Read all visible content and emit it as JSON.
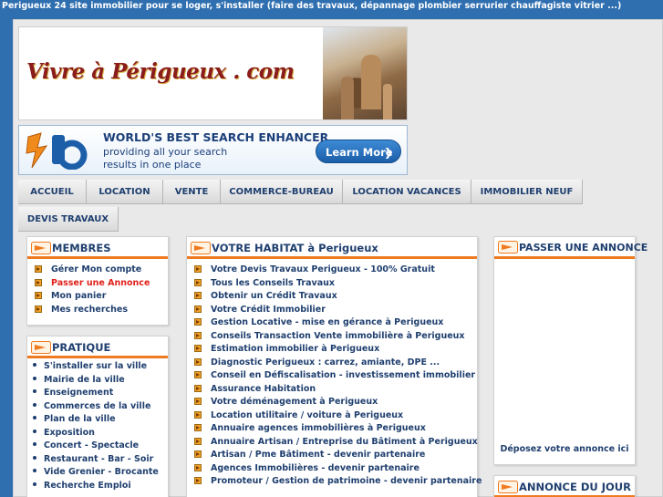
{
  "site_tagline": "Perigueux 24 site immobilier pour se loger, s'installer (faire des travaux, dépannage plombier serrurier chauffagiste vitrier ...)",
  "header": {
    "logo_text": "Vivre à Périgueux . com"
  },
  "banner": {
    "title": "WORLD'S BEST SEARCH ENHANCER",
    "line1": "providing all your search",
    "line2": "results in one place",
    "button_label": "Learn More"
  },
  "nav": {
    "items": [
      {
        "label": "ACCUEIL"
      },
      {
        "label": "LOCATION"
      },
      {
        "label": "VENTE"
      },
      {
        "label": "COMMERCE-BUREAU"
      },
      {
        "label": "LOCATION VACANCES"
      },
      {
        "label": "IMMOBILIER NEUF"
      },
      {
        "label": "DEVIS TRAVAUX"
      }
    ]
  },
  "membres": {
    "title": "MEMBRES",
    "items": [
      {
        "label": "Gérer Mon compte"
      },
      {
        "label": "Passer une Annonce"
      },
      {
        "label": "Mon panier"
      },
      {
        "label": "Mes recherches"
      }
    ]
  },
  "pratique": {
    "title": "PRATIQUE",
    "items": [
      {
        "label": "S'installer sur la ville"
      },
      {
        "label": "Mairie de la ville"
      },
      {
        "label": "Enseignement"
      },
      {
        "label": "Commerces de la ville"
      },
      {
        "label": "Plan de la ville"
      },
      {
        "label": "Exposition"
      },
      {
        "label": "Concert - Spectacle"
      },
      {
        "label": "Restaurant - Bar - Soir"
      },
      {
        "label": "Vide Grenier - Brocante"
      },
      {
        "label": "Recherche Emploi"
      }
    ]
  },
  "habitat": {
    "title": "VOTRE HABITAT à Perigueux",
    "items": [
      {
        "label": "Votre Devis Travaux Perigueux - 100% Gratuit"
      },
      {
        "label": "Tous les Conseils Travaux"
      },
      {
        "label": "Obtenir un Crédit Travaux"
      },
      {
        "label": "Votre Crédit Immobilier"
      },
      {
        "label": "Gestion Locative - mise en gérance à Perigueux"
      },
      {
        "label": "Conseils Transaction Vente immobilière à Perigueux"
      },
      {
        "label": "Estimation immobilier à Perigueux"
      },
      {
        "label": "Diagnostic Perigueux : carrez, amiante, DPE ..."
      },
      {
        "label": "Conseil en Défiscalisation - investissement immobilier"
      },
      {
        "label": "Assurance Habitation"
      },
      {
        "label": "Votre déménagement à Perigueux"
      },
      {
        "label": "Location utilitaire / voiture à Perigueux"
      },
      {
        "label": "Annuaire agences immobilières à Perigueux"
      },
      {
        "label": "Annuaire Artisan / Entreprise du Bâtiment à Perigueux"
      },
      {
        "label": "Artisan / Pme Bâtiment - devenir partenaire"
      },
      {
        "label": "Agences Immobilières - devenir partenaire"
      },
      {
        "label": "Promoteur / Gestion de patrimoine - devenir partenaire"
      }
    ]
  },
  "annonce": {
    "title": "PASSER UNE ANNONCE",
    "footer_text": "Déposez votre annonce ici"
  },
  "annonce_jour": {
    "title": "ANNONCE DU JOUR"
  },
  "colors": {
    "page_bg": "#2f6fb0",
    "accent": "#f07a1f",
    "text": "#1f3f6f",
    "link_red": "#e0211b"
  }
}
